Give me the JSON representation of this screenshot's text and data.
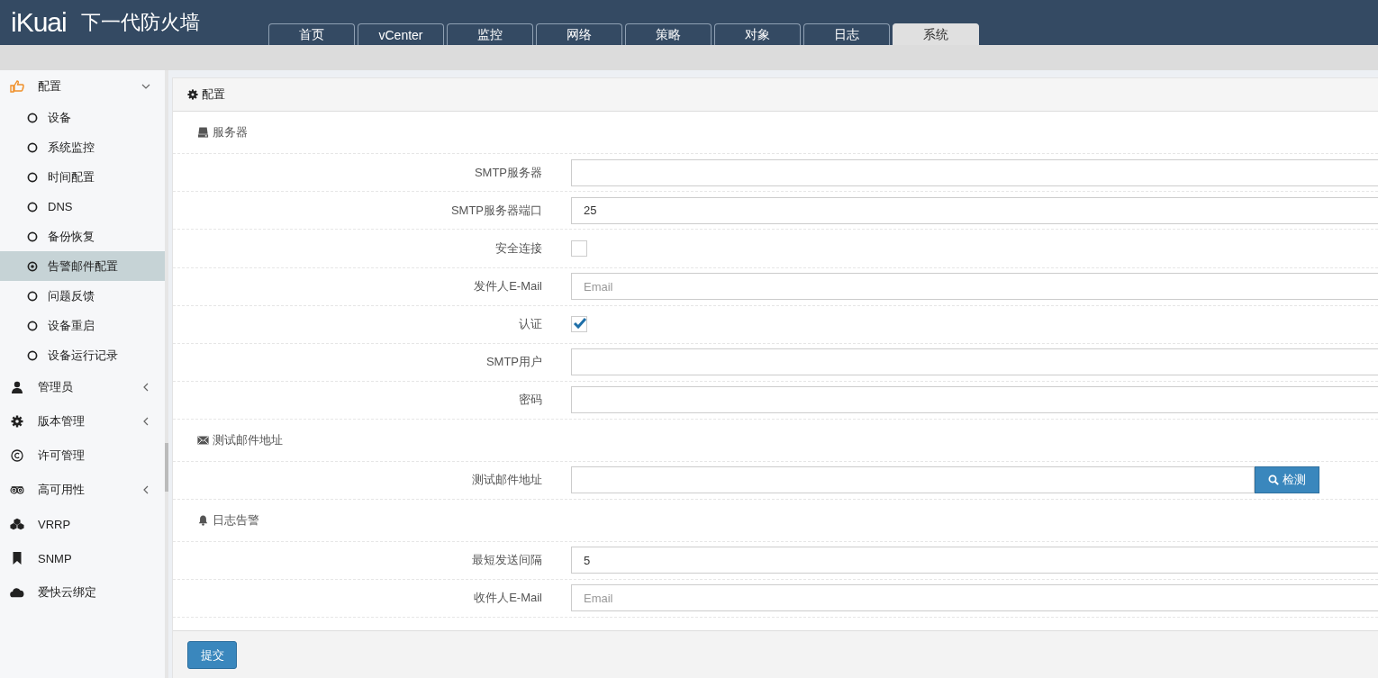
{
  "header": {
    "logo": "iKuai",
    "title": "下一代防火墙"
  },
  "tabs": [
    {
      "label": "首页",
      "selected": false
    },
    {
      "label": "vCenter",
      "selected": false
    },
    {
      "label": "监控",
      "selected": false
    },
    {
      "label": "网络",
      "selected": false
    },
    {
      "label": "策略",
      "selected": false
    },
    {
      "label": "对象",
      "selected": false
    },
    {
      "label": "日志",
      "selected": false
    },
    {
      "label": "系统",
      "selected": true
    }
  ],
  "sidebar": {
    "items": [
      {
        "label": "配置",
        "expanded": true,
        "children": [
          {
            "label": "设备",
            "selected": false
          },
          {
            "label": "系统监控",
            "selected": false
          },
          {
            "label": "时间配置",
            "selected": false
          },
          {
            "label": "DNS",
            "selected": false
          },
          {
            "label": "备份恢复",
            "selected": false
          },
          {
            "label": "告警邮件配置",
            "selected": true
          },
          {
            "label": "问题反馈",
            "selected": false
          },
          {
            "label": "设备重启",
            "selected": false
          },
          {
            "label": "设备运行记录",
            "selected": false
          }
        ]
      },
      {
        "label": "管理员",
        "expanded": false,
        "has_children": true
      },
      {
        "label": "版本管理",
        "expanded": false,
        "has_children": true
      },
      {
        "label": "许可管理",
        "expanded": false,
        "has_children": false
      },
      {
        "label": "高可用性",
        "expanded": false,
        "has_children": true
      },
      {
        "label": "VRRP",
        "expanded": false,
        "has_children": false
      },
      {
        "label": "SNMP",
        "expanded": false,
        "has_children": false
      },
      {
        "label": "爱快云绑定",
        "expanded": false,
        "has_children": false
      }
    ]
  },
  "panel": {
    "title": "配置",
    "sections": [
      {
        "title": "服务器",
        "rows": [
          {
            "kind": "text",
            "label": "SMTP服务器"
          },
          {
            "kind": "text",
            "label": "SMTP服务器端口",
            "value": "25"
          },
          {
            "kind": "checkbox",
            "label": "安全连接",
            "checked": false
          },
          {
            "kind": "text",
            "label": "发件人E-Mail",
            "placeholder": "Email"
          },
          {
            "kind": "checkbox",
            "label": "认证",
            "checked": true
          },
          {
            "kind": "text",
            "label": "SMTP用户"
          },
          {
            "kind": "text",
            "label": "密码"
          }
        ]
      },
      {
        "title": "测试邮件地址",
        "rows": [
          {
            "kind": "text_button",
            "label": "测试邮件地址",
            "button": "检测"
          }
        ]
      },
      {
        "title": "日志告警",
        "rows": [
          {
            "kind": "text",
            "label": "最短发送间隔",
            "value": "5"
          },
          {
            "kind": "text",
            "label": "收件人E-Mail",
            "placeholder": "Email"
          }
        ]
      }
    ],
    "submit": "提交"
  }
}
